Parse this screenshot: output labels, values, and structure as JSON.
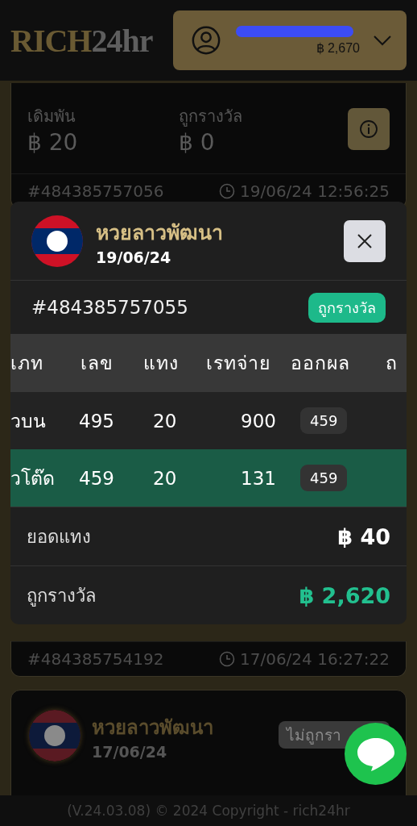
{
  "header": {
    "logo": {
      "part1": "RICH",
      "part2": "24hr"
    },
    "account": {
      "balance": "฿ 2,670",
      "phone_redacted": true
    }
  },
  "cards": [
    {
      "kind": "summary",
      "bet_label": "เดิมพัน",
      "bet_value": "฿ 20",
      "win_label": "ถูกรางวัล",
      "win_value": "฿ 0",
      "ticket": "#484385757056",
      "time": "19/06/24 12:56:25"
    },
    {
      "kind": "footer",
      "ticket": "#484385754192",
      "time": "17/06/24 16:27:22"
    },
    {
      "kind": "lottery",
      "title": "หวยลาวพัฒนา",
      "date": "17/06/24",
      "status": "ไม่ถูกรา",
      "won": false
    }
  ],
  "modal": {
    "title": "หวยลาวพัฒนา",
    "date": "19/06/24",
    "ticket": "#484385757055",
    "status": "ถูกรางวัล",
    "won": true,
    "table": {
      "columns": [
        "เภท",
        "เลข",
        "แทง",
        "เรทจ่าย",
        "ออกผล",
        "ถ"
      ],
      "rows": [
        {
          "type": "วบน",
          "number": "495",
          "bet": "20",
          "rate": "900",
          "result": "459",
          "won": false
        },
        {
          "type": "วโต๊ด",
          "number": "459",
          "bet": "20",
          "rate": "131",
          "result": "459",
          "won": true
        }
      ]
    },
    "total_label": "ยอดแทง",
    "total_value": "฿ 40",
    "prize_label": "ถูกรางวัล",
    "prize_value": "฿ 2,620"
  },
  "footer": {
    "copyright": "(V.24.03.08) © 2024 Copyright - rich24hr"
  }
}
